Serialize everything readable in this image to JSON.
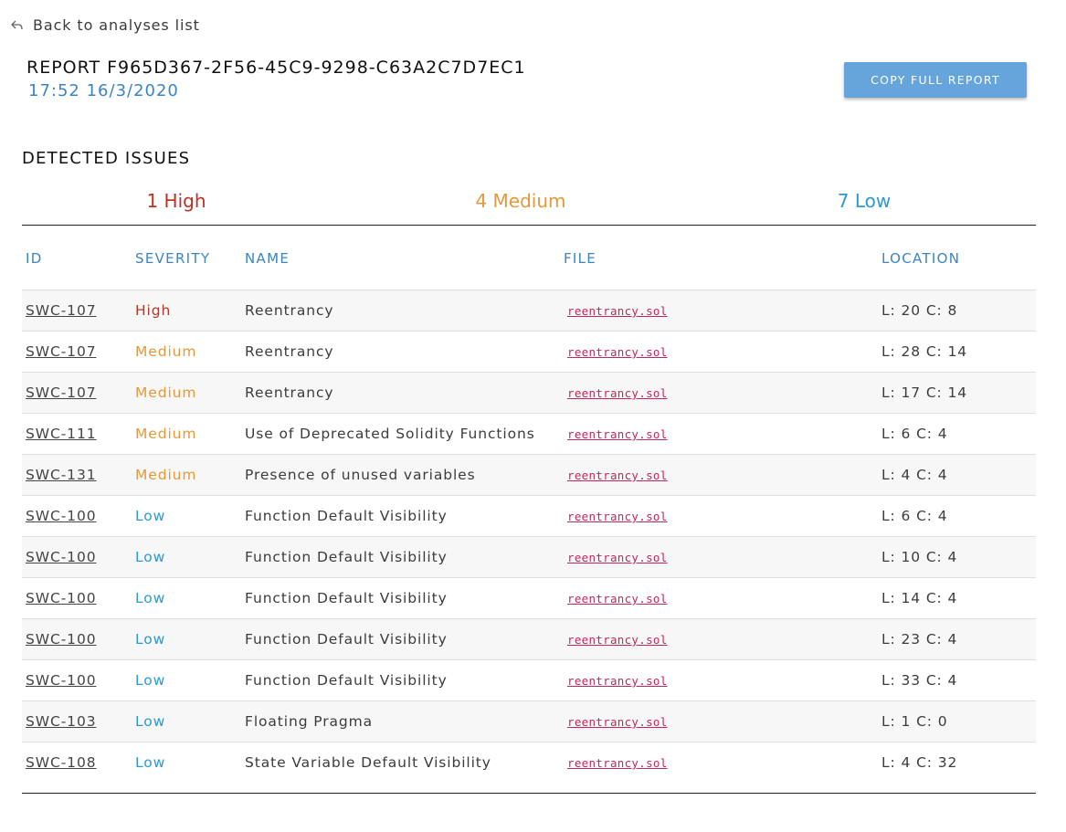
{
  "nav": {
    "back_label": "Back to analyses list",
    "back_icon": "reply-arrow-icon"
  },
  "report": {
    "title": "REPORT F965D367-2F56-45C9-9298-C63A2C7D7EC1",
    "datetime": "17:52 16/3/2020",
    "copy_button_label": "COPY FULL REPORT"
  },
  "issues_section": {
    "title": "DETECTED ISSUES",
    "summary": {
      "high": "1 High",
      "medium": "4 Medium",
      "low": "7 Low"
    }
  },
  "colors": {
    "high": "#b83425",
    "medium": "#e6983a",
    "low": "#2c98d4",
    "accent": "#3a84c7",
    "button": "#66a4dc",
    "file_link": "#c0285d"
  },
  "table": {
    "headers": {
      "id": "ID",
      "severity": "SEVERITY",
      "name": "NAME",
      "file": "FILE",
      "location": "LOCATION"
    },
    "rows": [
      {
        "id": "SWC-107",
        "severity": "High",
        "level": "high",
        "name": "Reentrancy",
        "file": "reentrancy.sol",
        "location": "L: 20 C: 8"
      },
      {
        "id": "SWC-107",
        "severity": "Medium",
        "level": "medium",
        "name": "Reentrancy",
        "file": "reentrancy.sol",
        "location": "L: 28 C: 14"
      },
      {
        "id": "SWC-107",
        "severity": "Medium",
        "level": "medium",
        "name": "Reentrancy",
        "file": "reentrancy.sol",
        "location": "L: 17 C: 14"
      },
      {
        "id": "SWC-111",
        "severity": "Medium",
        "level": "medium",
        "name": "Use of Deprecated Solidity Functions",
        "file": "reentrancy.sol",
        "location": "L: 6 C: 4"
      },
      {
        "id": "SWC-131",
        "severity": "Medium",
        "level": "medium",
        "name": "Presence of unused variables",
        "file": "reentrancy.sol",
        "location": "L: 4 C: 4"
      },
      {
        "id": "SWC-100",
        "severity": "Low",
        "level": "low",
        "name": "Function Default Visibility",
        "file": "reentrancy.sol",
        "location": "L: 6 C: 4"
      },
      {
        "id": "SWC-100",
        "severity": "Low",
        "level": "low",
        "name": "Function Default Visibility",
        "file": "reentrancy.sol",
        "location": "L: 10 C: 4"
      },
      {
        "id": "SWC-100",
        "severity": "Low",
        "level": "low",
        "name": "Function Default Visibility",
        "file": "reentrancy.sol",
        "location": "L: 14 C: 4"
      },
      {
        "id": "SWC-100",
        "severity": "Low",
        "level": "low",
        "name": "Function Default Visibility",
        "file": "reentrancy.sol",
        "location": "L: 23 C: 4"
      },
      {
        "id": "SWC-100",
        "severity": "Low",
        "level": "low",
        "name": "Function Default Visibility",
        "file": "reentrancy.sol",
        "location": "L: 33 C: 4"
      },
      {
        "id": "SWC-103",
        "severity": "Low",
        "level": "low",
        "name": "Floating Pragma",
        "file": "reentrancy.sol",
        "location": "L: 1 C: 0"
      },
      {
        "id": "SWC-108",
        "severity": "Low",
        "level": "low",
        "name": "State Variable Default Visibility",
        "file": "reentrancy.sol",
        "location": "L: 4 C: 32"
      }
    ]
  }
}
